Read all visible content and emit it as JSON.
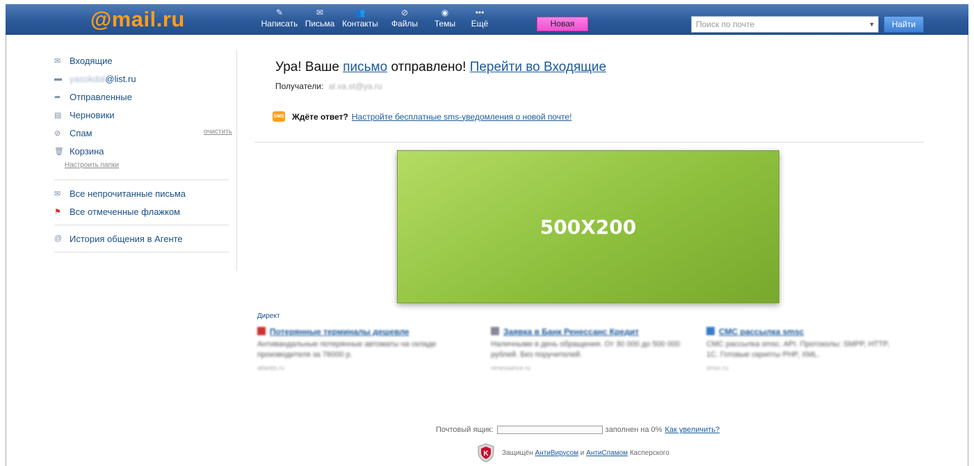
{
  "header": {
    "logo_text": "@mail.ru",
    "nav": [
      {
        "label": "Написать",
        "icon": "pen-icon"
      },
      {
        "label": "Письма",
        "icon": "envelope-icon"
      },
      {
        "label": "Контакты",
        "icon": "contacts-icon"
      },
      {
        "label": "Файлы",
        "icon": "paperclip-icon"
      },
      {
        "label": "Темы",
        "icon": "palette-icon"
      },
      {
        "label": "Ещё",
        "icon": "more-icon"
      }
    ],
    "new_badge": "Новая",
    "search_placeholder": "Поиск по почте",
    "search_button": "Найти"
  },
  "sidebar": {
    "inbox": "Входящие",
    "account_blurred": "yasokdal",
    "account_domain": "@list.ru",
    "sent": "Отправленные",
    "drafts": "Черновики",
    "spam": "Спам",
    "spam_clear": "очистить",
    "trash": "Корзина",
    "setup_folders": "Настроить папки",
    "unread": "Все непрочитанные письма",
    "flagged": "Все отмеченные флажком",
    "agent_history": "История общения в Агенте"
  },
  "main": {
    "headline_pre": "Ура! Ваше",
    "headline_link1": "письмо",
    "headline_mid": "отправлено!",
    "headline_link2": "Перейти во Входящие",
    "recipients_label": "Получатели:",
    "recipients_value": "al.va.st@ya.ru",
    "sms_badge": "SMS",
    "sms_question": "Ждёте ответ?",
    "sms_link": "Настройте бесплатные sms-уведомления о новой почте!",
    "banner_text": "500X200",
    "direct_label": "Директ",
    "ads": [
      {
        "title": "Потерянные терминалы дешевле",
        "text": "Антивандальные потерянные автоматы на складе производителя за 76000 р.",
        "url": "atlantis.ru"
      },
      {
        "title": "Заявка в Банк Ренессанс Кредит",
        "text": "Наличными в день обращения. От 30 000 до 500 000 рублей. Без поручителей.",
        "url": "renessance.ru"
      },
      {
        "title": "СМС рассылка smsc",
        "text": "СМС рассылка smsc. API. Протоколы: SMPP, HTTP, 1С. Готовые скрипты PHP, XML.",
        "url": "smsc.ru"
      }
    ],
    "quota_label": "Почтовый ящик:",
    "quota_fill_percent": 0,
    "quota_text": "заполнен на 0%",
    "quota_link": "Как увеличить?",
    "protect_pre": "Защищён",
    "protect_link1": "АнтиВирусом",
    "protect_and": "и",
    "protect_link2": "АнтиСпамом",
    "protect_post": "Касперского"
  },
  "colors": {
    "topbar": "#2c5a9a",
    "logo": "#ff9e1b",
    "link": "#1a5a9e",
    "banner": "#8ec03e",
    "new_badge": "#f050d4"
  }
}
